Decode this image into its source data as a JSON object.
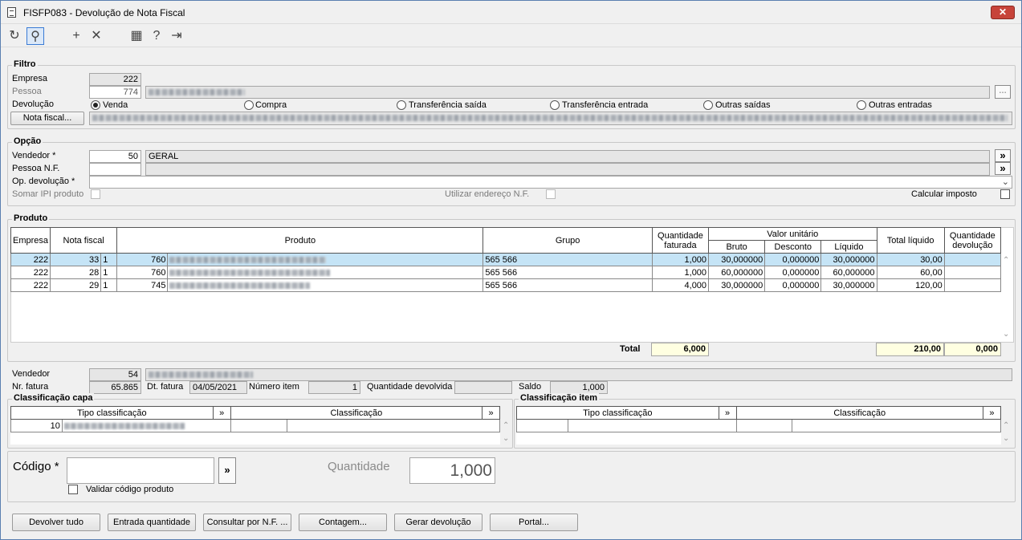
{
  "window": {
    "title": "FISFP083 - Devolução de Nota Fiscal",
    "close_label": "✕"
  },
  "toolbar": {
    "items": [
      {
        "name": "refresh-icon",
        "glyph": "↻"
      },
      {
        "name": "search-icon",
        "glyph": "⚲"
      },
      {
        "name": "add-icon",
        "glyph": "+"
      },
      {
        "name": "delete-icon",
        "glyph": "✕"
      },
      {
        "name": "calendar-icon",
        "glyph": "▦"
      },
      {
        "name": "help-icon",
        "glyph": "?"
      },
      {
        "name": "exit-icon",
        "glyph": "⇥"
      }
    ]
  },
  "filtro": {
    "legend": "Filtro",
    "empresa_label": "Empresa",
    "empresa_value": "222",
    "pessoa_label": "Pessoa",
    "pessoa_value": "774",
    "devolucao_label": "Devolução",
    "radios": [
      "Venda",
      "Compra",
      "Transferência saída",
      "Transferência entrada",
      "Outras saídas",
      "Outras entradas"
    ],
    "nota_fiscal_button": "Nota fiscal..."
  },
  "opcao": {
    "legend": "Opção",
    "vendedor_label": "Vendedor *",
    "vendedor_value": "50",
    "vendedor_name": "GERAL",
    "pessoa_nf_label": "Pessoa N.F.",
    "op_devolucao_label": "Op. devolução *",
    "somar_ipi_label": "Somar IPI produto",
    "utilizar_endereco_label": "Utilizar endereço N.F.",
    "calcular_imposto_label": "Calcular imposto",
    "expand_label": "»"
  },
  "produto": {
    "legend": "Produto",
    "headers": {
      "empresa": "Empresa",
      "nota_fiscal": "Nota fiscal",
      "produto": "Produto",
      "grupo": "Grupo",
      "qtd_faturada": "Quantidade faturada",
      "valor_unitario": "Valor unitário",
      "bruto": "Bruto",
      "desconto": "Desconto",
      "liquido": "Líquido",
      "total_liquido": "Total líquido",
      "qtd_devolucao": "Quantidade devolução"
    },
    "rows": [
      {
        "empresa": "222",
        "nota": "33",
        "serie": "1",
        "codigo": "760",
        "grupo": "565 566",
        "qtd": "1,000",
        "bruto": "30,000000",
        "desconto": "0,000000",
        "liquido": "30,000000",
        "total": "30,00",
        "devol": ""
      },
      {
        "empresa": "222",
        "nota": "28",
        "serie": "1",
        "codigo": "760",
        "grupo": "565 566",
        "qtd": "1,000",
        "bruto": "60,000000",
        "desconto": "0,000000",
        "liquido": "60,000000",
        "total": "60,00",
        "devol": ""
      },
      {
        "empresa": "222",
        "nota": "29",
        "serie": "1",
        "codigo": "745",
        "grupo": "565 566",
        "qtd": "4,000",
        "bruto": "30,000000",
        "desconto": "0,000000",
        "liquido": "30,000000",
        "total": "120,00",
        "devol": ""
      }
    ],
    "total_label": "Total",
    "total_qtd": "6,000",
    "total_liquido": "210,00",
    "total_devolucao": "0,000"
  },
  "detalhe": {
    "vendedor_label": "Vendedor",
    "vendedor_value": "54",
    "nr_fatura_label": "Nr. fatura",
    "nr_fatura_value": "65.865",
    "dt_fatura_label": "Dt. fatura",
    "dt_fatura_value": "04/05/2021",
    "numero_item_label": "Número item",
    "numero_item_value": "1",
    "qtd_devolvida_label": "Quantidade devolvida",
    "qtd_devolvida_value": "",
    "saldo_label": "Saldo",
    "saldo_value": "1,000"
  },
  "class_capa": {
    "legend": "Classificação capa",
    "tipo_header": "Tipo classificação",
    "class_header": "Classificação",
    "row_tipo": "10"
  },
  "class_item": {
    "legend": "Classificação item",
    "tipo_header": "Tipo classificação",
    "class_header": "Classificação"
  },
  "codigo": {
    "label": "Código *",
    "quantidade_label": "Quantidade",
    "quantidade_value": "1,000",
    "validar_label": "Validar código produto"
  },
  "buttons": {
    "devolver_tudo": "Devolver tudo",
    "entrada_quantidade": "Entrada quantidade",
    "consultar_nf": "Consultar por N.F. ...",
    "contagem": "Contagem...",
    "gerar_devolucao": "Gerar devolução",
    "portal": "Portal..."
  }
}
